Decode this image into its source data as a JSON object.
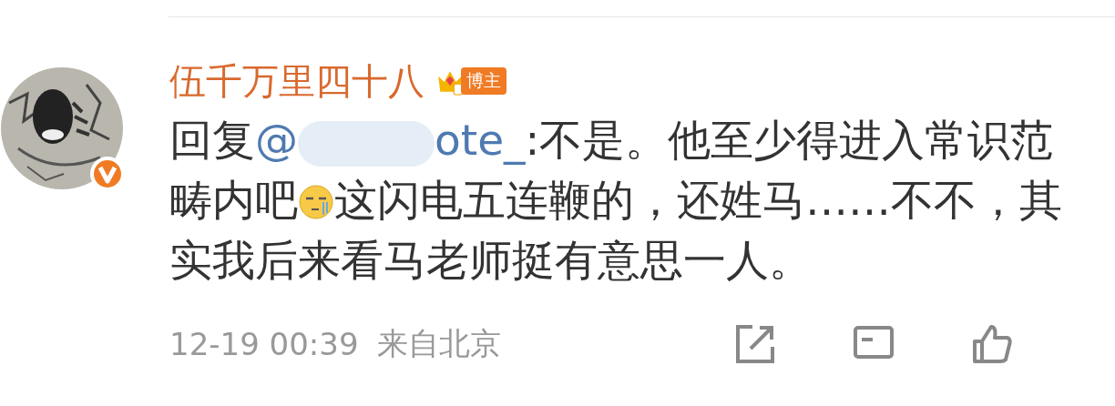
{
  "comment": {
    "author": "伍千万里四十八",
    "badge": "博主",
    "verified": true,
    "reply_prefix": "回复",
    "mention_at": "@",
    "mention_tail": "ote_",
    "mention_blurred": true,
    "text_before_emoji": ":不是。他至少得进入常识范畴内吧",
    "text_after_emoji": "这闪电五连鞭的，还姓马……不不，其实我后来看马老师挺有意思一人。",
    "time": "12-19 00:39",
    "location": "来自北京"
  }
}
